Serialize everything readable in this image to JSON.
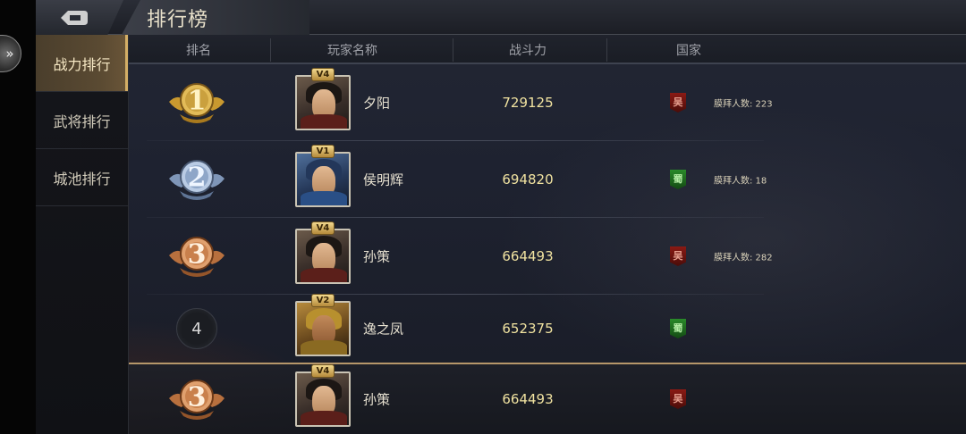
{
  "header": {
    "title": "排行榜"
  },
  "sidebar": {
    "tabs": [
      {
        "label": "战力排行",
        "active": true
      },
      {
        "label": "武将排行",
        "active": false
      },
      {
        "label": "城池排行",
        "active": false
      }
    ]
  },
  "table": {
    "columns": [
      "排名",
      "玩家名称",
      "战斗力",
      "国家"
    ],
    "rows": [
      {
        "rank": "1",
        "name": "夕阳",
        "power": "729125",
        "portrait_tag": "V4",
        "country": "吴",
        "worship": "膜拜人数: 223"
      },
      {
        "rank": "2",
        "name": "侯明辉",
        "power": "694820",
        "portrait_tag": "V1",
        "country": "蜀",
        "worship": "膜拜人数: 18"
      },
      {
        "rank": "3",
        "name": "孙策",
        "power": "664493",
        "portrait_tag": "V4",
        "country": "吴",
        "worship": "膜拜人数: 282"
      },
      {
        "rank": "4",
        "name": "逸之凤",
        "power": "652375",
        "portrait_tag": "V2",
        "country": "蜀",
        "worship": ""
      }
    ],
    "self_row": {
      "rank": "3",
      "name": "孙策",
      "power": "664493",
      "portrait_tag": "V4",
      "country": "吴"
    }
  },
  "colors": {
    "gold_badge": "#d9b04a",
    "silver_badge": "#9fb6d6",
    "bronze_badge": "#d08a58",
    "power_text": "#f0e2a0",
    "wu_flag": "#8a1a14",
    "shu_flag": "#2a8a2a"
  },
  "icons": {
    "back": "back-arrow-icon",
    "expand": "double-chevron-right-icon"
  }
}
